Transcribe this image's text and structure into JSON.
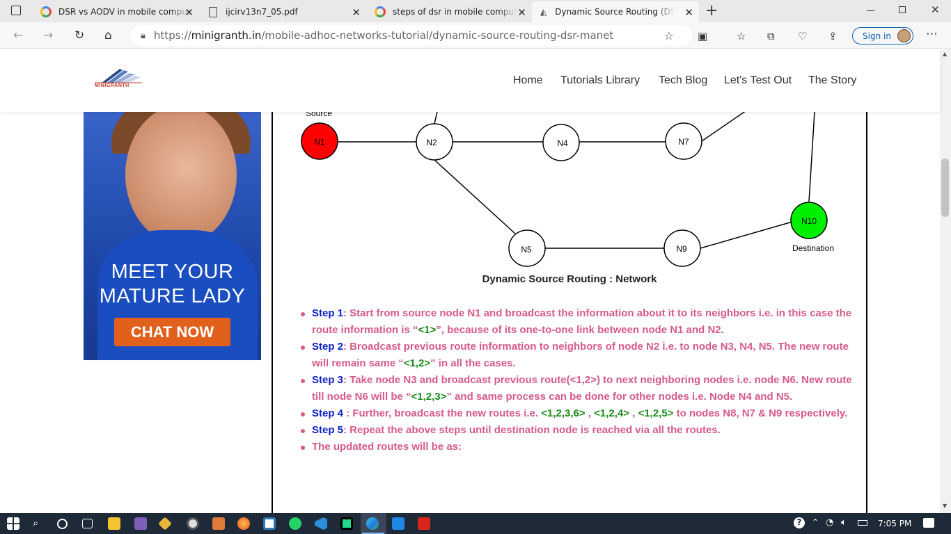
{
  "browser": {
    "tabs": [
      {
        "title": "DSR vs AODV in mobile computing",
        "icon": "google-icon"
      },
      {
        "title": "ijcirv13n7_05.pdf",
        "icon": "document-icon"
      },
      {
        "title": "steps of dsr in mobile computing",
        "icon": "google-icon"
      },
      {
        "title": "Dynamic Source Routing (DSR) | MANET",
        "icon": "site-icon",
        "active": true
      }
    ],
    "url_prefix": "https://",
    "url_domain": "minigranth.in",
    "url_path": "/mobile-adhoc-networks-tutorial/dynamic-source-routing-dsr-manet",
    "sign_in": "Sign in"
  },
  "site": {
    "logo_text": "MINIGRANTH",
    "nav": [
      "Home",
      "Tutorials Library",
      "Tech Blog",
      "Let's Test Out",
      "The Story"
    ]
  },
  "ad": {
    "line1": "MEET YOUR",
    "line2": "MATURE LADY",
    "cta": "CHAT NOW"
  },
  "diagram": {
    "source_label": "Source",
    "destination_label": "Destination",
    "nodes": [
      "N1",
      "N2",
      "N4",
      "N7",
      "N5",
      "N9",
      "N10"
    ],
    "caption": "Dynamic Source Routing : Network",
    "colors": {
      "source": "#ff0000",
      "destination": "#00ee00"
    }
  },
  "steps": {
    "s1_label": "Step 1",
    "s1_a": ": Start from source node N1 and broadcast the information about it to its neighbors i.e. in this case the route information is “",
    "s1_route": "<1>",
    "s1_b": "”, because of its one-to-one link between node N1 and N2.",
    "s2_label": "Step 2",
    "s2_a": ": Broadcast previous route information to neighbors of node N2 i.e. to node N3, N4, N5. The new route will remain same “",
    "s2_route": "<1,2>",
    "s2_b": "” in all the cases.",
    "s3_label": "Step 3",
    "s3_a": ": Take node N3 and broadcast previous route(<1,2>) to next neighboring nodes i.e. node N6. New route till node N6 will be “",
    "s3_route": "<1,2,3>",
    "s3_b": "” and same process can be done for other nodes i.e. Node N4 and N5.",
    "s4_label": "Step 4",
    "s4_a": " : Further, broadcast the new routes i.e. ",
    "s4_r1": "<1,2,3,6>",
    "s4_sep1": " , ",
    "s4_r2": "<1,2,4>",
    "s4_sep2": " , ",
    "s4_r3": "<1,2,5>",
    "s4_b": " to nodes N8, N7 & N9 respectively.",
    "s5_label": "Step 5",
    "s5_a": ": Repeat the above steps until destination node is reached via all the routes.",
    "s6": "The updated routes will be as:"
  },
  "taskbar": {
    "time": "7:05 PM"
  }
}
